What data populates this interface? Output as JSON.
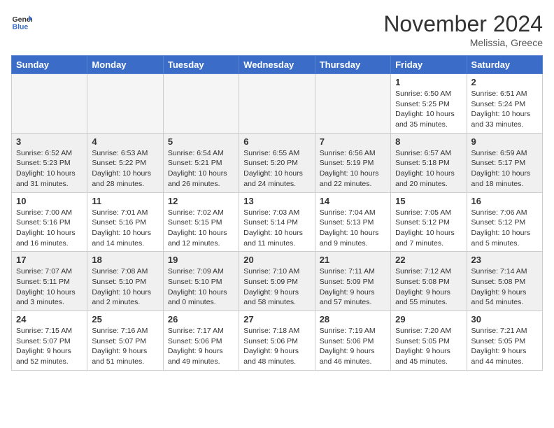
{
  "header": {
    "logo_general": "General",
    "logo_blue": "Blue",
    "month_title": "November 2024",
    "location": "Melissia, Greece"
  },
  "weekdays": [
    "Sunday",
    "Monday",
    "Tuesday",
    "Wednesday",
    "Thursday",
    "Friday",
    "Saturday"
  ],
  "weeks": [
    [
      {
        "day": "",
        "info": "",
        "empty": true
      },
      {
        "day": "",
        "info": "",
        "empty": true
      },
      {
        "day": "",
        "info": "",
        "empty": true
      },
      {
        "day": "",
        "info": "",
        "empty": true
      },
      {
        "day": "",
        "info": "",
        "empty": true
      },
      {
        "day": "1",
        "info": "Sunrise: 6:50 AM\nSunset: 5:25 PM\nDaylight: 10 hours\nand 35 minutes."
      },
      {
        "day": "2",
        "info": "Sunrise: 6:51 AM\nSunset: 5:24 PM\nDaylight: 10 hours\nand 33 minutes."
      }
    ],
    [
      {
        "day": "3",
        "info": "Sunrise: 6:52 AM\nSunset: 5:23 PM\nDaylight: 10 hours\nand 31 minutes."
      },
      {
        "day": "4",
        "info": "Sunrise: 6:53 AM\nSunset: 5:22 PM\nDaylight: 10 hours\nand 28 minutes."
      },
      {
        "day": "5",
        "info": "Sunrise: 6:54 AM\nSunset: 5:21 PM\nDaylight: 10 hours\nand 26 minutes."
      },
      {
        "day": "6",
        "info": "Sunrise: 6:55 AM\nSunset: 5:20 PM\nDaylight: 10 hours\nand 24 minutes."
      },
      {
        "day": "7",
        "info": "Sunrise: 6:56 AM\nSunset: 5:19 PM\nDaylight: 10 hours\nand 22 minutes."
      },
      {
        "day": "8",
        "info": "Sunrise: 6:57 AM\nSunset: 5:18 PM\nDaylight: 10 hours\nand 20 minutes."
      },
      {
        "day": "9",
        "info": "Sunrise: 6:59 AM\nSunset: 5:17 PM\nDaylight: 10 hours\nand 18 minutes."
      }
    ],
    [
      {
        "day": "10",
        "info": "Sunrise: 7:00 AM\nSunset: 5:16 PM\nDaylight: 10 hours\nand 16 minutes."
      },
      {
        "day": "11",
        "info": "Sunrise: 7:01 AM\nSunset: 5:16 PM\nDaylight: 10 hours\nand 14 minutes."
      },
      {
        "day": "12",
        "info": "Sunrise: 7:02 AM\nSunset: 5:15 PM\nDaylight: 10 hours\nand 12 minutes."
      },
      {
        "day": "13",
        "info": "Sunrise: 7:03 AM\nSunset: 5:14 PM\nDaylight: 10 hours\nand 11 minutes."
      },
      {
        "day": "14",
        "info": "Sunrise: 7:04 AM\nSunset: 5:13 PM\nDaylight: 10 hours\nand 9 minutes."
      },
      {
        "day": "15",
        "info": "Sunrise: 7:05 AM\nSunset: 5:12 PM\nDaylight: 10 hours\nand 7 minutes."
      },
      {
        "day": "16",
        "info": "Sunrise: 7:06 AM\nSunset: 5:12 PM\nDaylight: 10 hours\nand 5 minutes."
      }
    ],
    [
      {
        "day": "17",
        "info": "Sunrise: 7:07 AM\nSunset: 5:11 PM\nDaylight: 10 hours\nand 3 minutes."
      },
      {
        "day": "18",
        "info": "Sunrise: 7:08 AM\nSunset: 5:10 PM\nDaylight: 10 hours\nand 2 minutes."
      },
      {
        "day": "19",
        "info": "Sunrise: 7:09 AM\nSunset: 5:10 PM\nDaylight: 10 hours\nand 0 minutes."
      },
      {
        "day": "20",
        "info": "Sunrise: 7:10 AM\nSunset: 5:09 PM\nDaylight: 9 hours\nand 58 minutes."
      },
      {
        "day": "21",
        "info": "Sunrise: 7:11 AM\nSunset: 5:09 PM\nDaylight: 9 hours\nand 57 minutes."
      },
      {
        "day": "22",
        "info": "Sunrise: 7:12 AM\nSunset: 5:08 PM\nDaylight: 9 hours\nand 55 minutes."
      },
      {
        "day": "23",
        "info": "Sunrise: 7:14 AM\nSunset: 5:08 PM\nDaylight: 9 hours\nand 54 minutes."
      }
    ],
    [
      {
        "day": "24",
        "info": "Sunrise: 7:15 AM\nSunset: 5:07 PM\nDaylight: 9 hours\nand 52 minutes."
      },
      {
        "day": "25",
        "info": "Sunrise: 7:16 AM\nSunset: 5:07 PM\nDaylight: 9 hours\nand 51 minutes."
      },
      {
        "day": "26",
        "info": "Sunrise: 7:17 AM\nSunset: 5:06 PM\nDaylight: 9 hours\nand 49 minutes."
      },
      {
        "day": "27",
        "info": "Sunrise: 7:18 AM\nSunset: 5:06 PM\nDaylight: 9 hours\nand 48 minutes."
      },
      {
        "day": "28",
        "info": "Sunrise: 7:19 AM\nSunset: 5:06 PM\nDaylight: 9 hours\nand 46 minutes."
      },
      {
        "day": "29",
        "info": "Sunrise: 7:20 AM\nSunset: 5:05 PM\nDaylight: 9 hours\nand 45 minutes."
      },
      {
        "day": "30",
        "info": "Sunrise: 7:21 AM\nSunset: 5:05 PM\nDaylight: 9 hours\nand 44 minutes."
      }
    ]
  ]
}
